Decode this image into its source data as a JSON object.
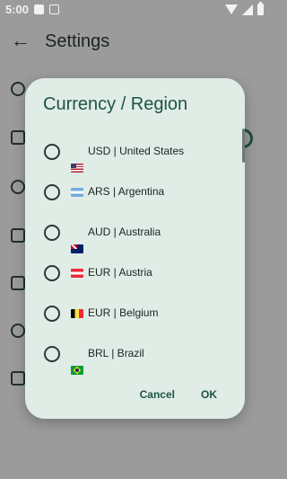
{
  "status_bar": {
    "time": "5:00",
    "left_icons": [
      "image-icon",
      "text-icon"
    ],
    "right_icons": [
      "wifi-icon",
      "signal-icon",
      "battery-icon"
    ]
  },
  "app_bar": {
    "title": "Settings",
    "back_icon": "arrow-left-icon"
  },
  "dialog": {
    "title": "Currency / Region",
    "options": [
      {
        "code": "USD",
        "separator": "|",
        "country": "United States",
        "flag": "us-flag-icon",
        "label": "USD  |  United States"
      },
      {
        "code": "ARS",
        "separator": "|",
        "country": "Argentina",
        "flag": "ar-flag-icon",
        "label": "ARS  |  Argentina"
      },
      {
        "code": "AUD",
        "separator": "|",
        "country": "Australia",
        "flag": "au-flag-icon",
        "label": "AUD  |  Australia"
      },
      {
        "code": "EUR",
        "separator": "|",
        "country": "Austria",
        "flag": "at-flag-icon",
        "label": "EUR  |  Austria"
      },
      {
        "code": "EUR",
        "separator": "|",
        "country": "Belgium",
        "flag": "be-flag-icon",
        "label": "EUR  |  Belgium"
      },
      {
        "code": "BRL",
        "separator": "|",
        "country": "Brazil",
        "flag": "br-flag-icon",
        "label": "BRL  |  Brazil"
      }
    ],
    "cancel_label": "Cancel",
    "ok_label": "OK"
  },
  "colors": {
    "scrim": "#9b9b9b",
    "dialog_background": "#e0ece6",
    "accent": "#1d5446"
  }
}
